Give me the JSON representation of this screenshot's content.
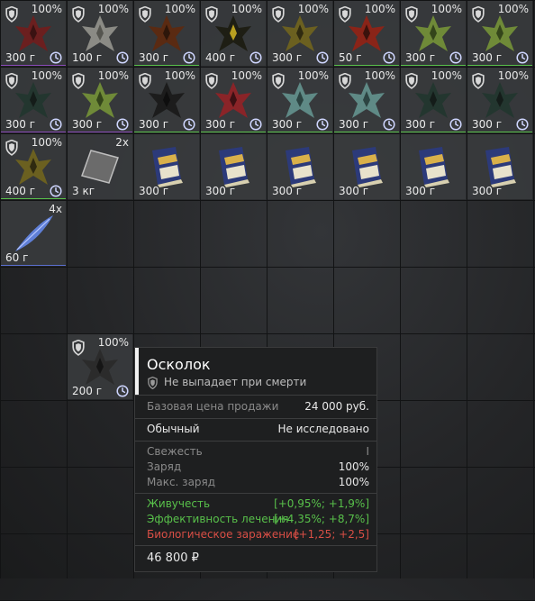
{
  "colors": {
    "green": "#58c04a",
    "red": "#d84e45",
    "purple": "#8a4bb8",
    "blue": "#5b6fd0"
  },
  "inventory": {
    "items": [
      {
        "pct": "100%",
        "weight": "300 г",
        "art": "red-dark"
      },
      {
        "pct": "100%",
        "weight": "100 г",
        "art": "grey-rock"
      },
      {
        "pct": "100%",
        "weight": "300 г",
        "art": "brown-orb"
      },
      {
        "pct": "100%",
        "weight": "400 г",
        "art": "black-spiky"
      },
      {
        "pct": "100%",
        "weight": "300 г",
        "art": "olive-spiky"
      },
      {
        "pct": "100%",
        "weight": "50 г",
        "art": "red-bone"
      },
      {
        "pct": "100%",
        "weight": "300 г",
        "art": "green-crystal"
      },
      {
        "pct": "100%",
        "weight": "300 г",
        "art": "green-crystal"
      },
      {
        "pct": "100%",
        "weight": "300 г",
        "art": "dark-teal"
      },
      {
        "pct": "100%",
        "weight": "300 г",
        "art": "green-crystal"
      },
      {
        "pct": "100%",
        "weight": "300 г",
        "art": "black-cluster"
      },
      {
        "pct": "100%",
        "weight": "300 г",
        "art": "red-crystal"
      },
      {
        "pct": "100%",
        "weight": "300 г",
        "art": "teal-crystal"
      },
      {
        "pct": "100%",
        "weight": "300 г",
        "art": "teal-crystal"
      },
      {
        "pct": "100%",
        "weight": "300 г",
        "art": "dark-teal"
      },
      {
        "pct": "100%",
        "weight": "300 г",
        "art": "dark-teal"
      },
      {
        "pct": "100%",
        "weight": "400 г",
        "art": "olive-spiky"
      },
      {
        "count": "2x",
        "weight": "3 кг",
        "art": "plate"
      },
      {
        "weight": "300 г",
        "art": "book"
      },
      {
        "weight": "300 г",
        "art": "book"
      },
      {
        "weight": "300 г",
        "art": "book"
      },
      {
        "weight": "300 г",
        "art": "book"
      },
      {
        "weight": "300 г",
        "art": "book"
      },
      {
        "weight": "300 г",
        "art": "book"
      },
      {
        "count": "4x",
        "weight": "60 г",
        "art": "feather"
      },
      {
        "pct": "100%",
        "weight": "200 г",
        "art": "black-shard"
      }
    ]
  },
  "tooltip": {
    "title": "Осколок",
    "drop_note": "Не выпадает при смерти",
    "base_price_label": "Базовая цена продажи",
    "base_price_value": "24 000 руб.",
    "rarity_label": "Обычный",
    "research_value": "Не исследовано",
    "freshness_label": "Свежесть",
    "freshness_value": "I",
    "charge_label": "Заряд",
    "charge_value": "100%",
    "max_charge_label": "Макс. заряд",
    "max_charge_value": "100%",
    "vitality_label": "Живучесть",
    "vitality_value": "[+0,95%; +1,9%]",
    "healing_label": "Эффективность лечения",
    "healing_value": "[+4,35%; +8,7%]",
    "bio_label": "Биологическое заражение",
    "bio_value": "[+1,25; +2,5]",
    "price": "46 800 ₽"
  }
}
